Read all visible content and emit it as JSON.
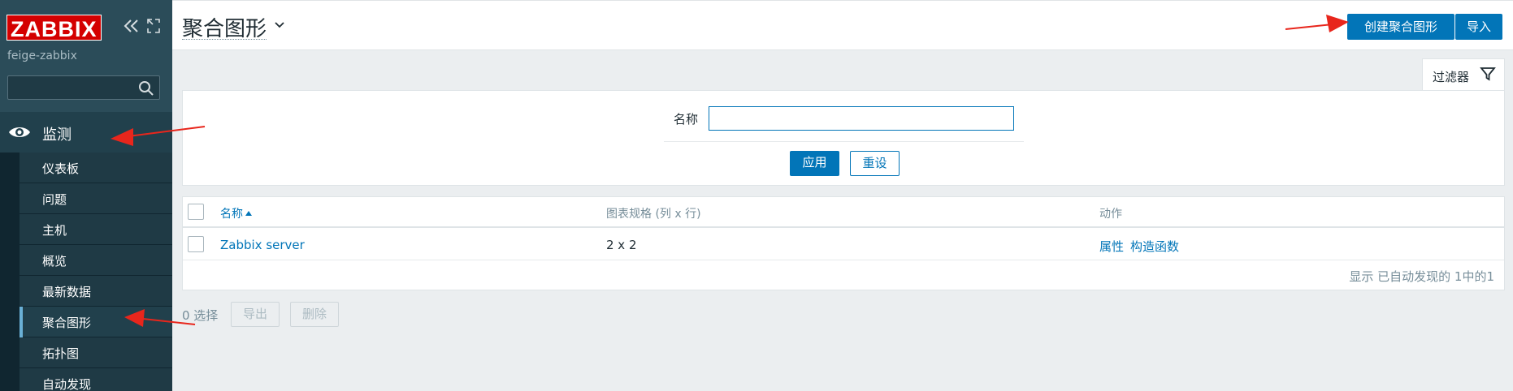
{
  "app": {
    "logo_text": "ZABBIX",
    "server_name": "feige-zabbix",
    "search_placeholder": ""
  },
  "sidebar": {
    "section_label": "监测",
    "items": [
      {
        "label": "仪表板",
        "active": false
      },
      {
        "label": "问题",
        "active": false
      },
      {
        "label": "主机",
        "active": false
      },
      {
        "label": "概览",
        "active": false
      },
      {
        "label": "最新数据",
        "active": false
      },
      {
        "label": "聚合图形",
        "active": true
      },
      {
        "label": "拓扑图",
        "active": false
      },
      {
        "label": "自动发现",
        "active": false
      }
    ]
  },
  "header": {
    "title": "聚合图形",
    "create_button": "创建聚合图形",
    "import_button": "导入"
  },
  "filter": {
    "tab_label": "过滤器",
    "name_label": "名称",
    "name_value": "",
    "apply_button": "应用",
    "reset_button": "重设"
  },
  "table": {
    "columns": {
      "name": "名称",
      "size": "图表规格 (列 x 行)",
      "actions": "动作"
    },
    "rows": [
      {
        "name": "Zabbix server",
        "size": "2 x 2",
        "action_1": "属性",
        "action_2": "构造函数"
      }
    ],
    "footer": "显示 已自动发现的 1中的1"
  },
  "bulk_actions": {
    "selected": "0 选择",
    "export_button": "导出",
    "delete_button": "删除"
  },
  "colors": {
    "sidebar_bg": "#2b4c59",
    "accent": "#0275b8",
    "logo_red": "#d40000",
    "annotation_arrow": "#e8261c"
  }
}
